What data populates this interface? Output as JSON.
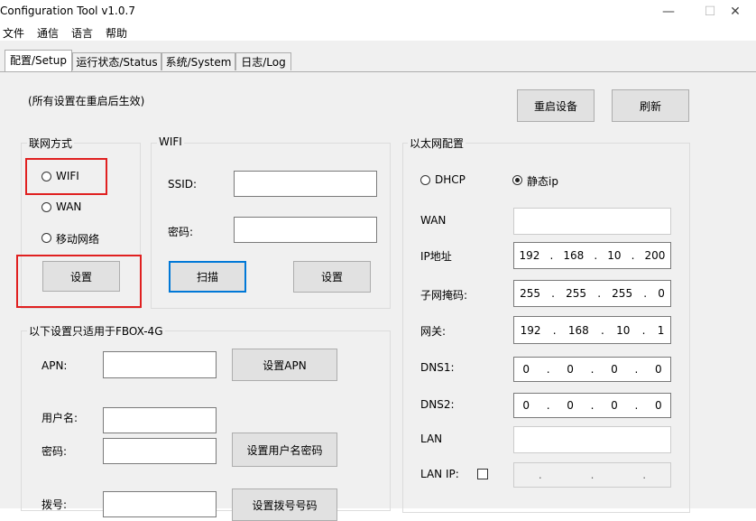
{
  "window": {
    "title": "Configuration Tool v1.0.7",
    "minimize": "—",
    "maximize": "☐",
    "close": "✕"
  },
  "menu": [
    "文件",
    "通信",
    "语言",
    "帮助"
  ],
  "tabs": [
    "配置/Setup",
    "运行状态/Status",
    "系统/System",
    "日志/Log"
  ],
  "setup": {
    "note": "(所有设置在重启后生效)",
    "restart_button": "重启设备",
    "refresh_button": "刷新",
    "network_mode": {
      "title": "联网方式",
      "options": [
        "WIFI",
        "WAN",
        "移动网络"
      ],
      "set_button": "设置"
    },
    "wifi": {
      "title": "WIFI",
      "ssid_label": "SSID:",
      "ssid_value": "",
      "password_label": "密码:",
      "password_value": "",
      "scan_button": "扫描",
      "set_button": "设置"
    },
    "fbox": {
      "title": "以下设置只适用于FBOX-4G",
      "apn_label": "APN:",
      "apn_value": "",
      "apn_button": "设置APN",
      "username_label": "用户名:",
      "username_value": "",
      "password_label": "密码:",
      "password_value": "",
      "userpass_button": "设置用户名密码",
      "dial_label": "拨号:",
      "dial_value": "",
      "dial_button": "设置拨号号码"
    },
    "ethernet": {
      "title": "以太网配置",
      "dhcp_label": "DHCP",
      "static_label": "静态ip",
      "wan_label": "WAN",
      "wan_value": "",
      "ip_label": "IP地址",
      "ip": [
        "192",
        "168",
        "10",
        "200"
      ],
      "mask_label": "子网掩码:",
      "mask": [
        "255",
        "255",
        "255",
        "0"
      ],
      "gateway_label": "网关:",
      "gateway": [
        "192",
        "168",
        "10",
        "1"
      ],
      "dns1_label": "DNS1:",
      "dns1": [
        "0",
        "0",
        "0",
        "0"
      ],
      "dns2_label": "DNS2:",
      "dns2": [
        "0",
        "0",
        "0",
        "0"
      ],
      "lan_label": "LAN",
      "lan_value": "",
      "lanip_label": "LAN IP:",
      "lanip_dots": [
        ".",
        ".",
        "."
      ]
    }
  }
}
